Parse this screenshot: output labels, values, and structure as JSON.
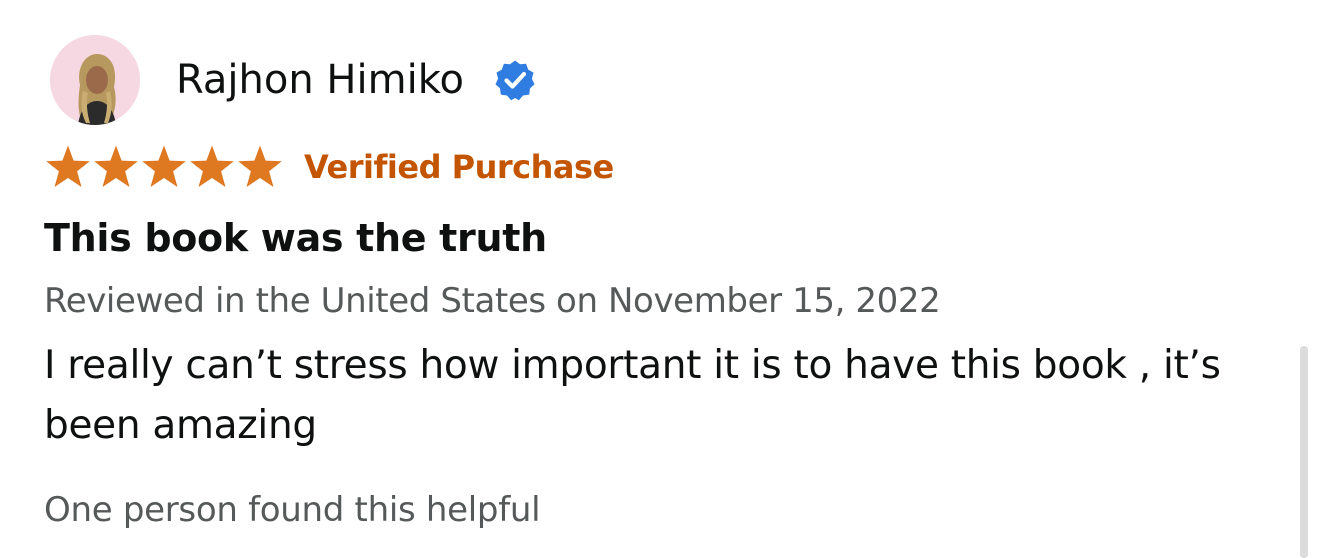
{
  "reviewer": {
    "name": "Rajhon Himiko",
    "avatar_icon": "profile-avatar",
    "verified_icon": "check-badge-icon",
    "verified_color": "#2f7de1"
  },
  "rating": {
    "stars": 5,
    "max_stars": 5,
    "star_color": "#de7921",
    "verified_label": "Verified Purchase",
    "verified_label_color": "#c45500"
  },
  "review": {
    "title": "This book was the truth",
    "date_line": "Reviewed in the United States on November 15, 2022",
    "body": "I really can’t stress how important it is to have this book , it’s been amazing",
    "helpful": "One person found this helpful"
  }
}
